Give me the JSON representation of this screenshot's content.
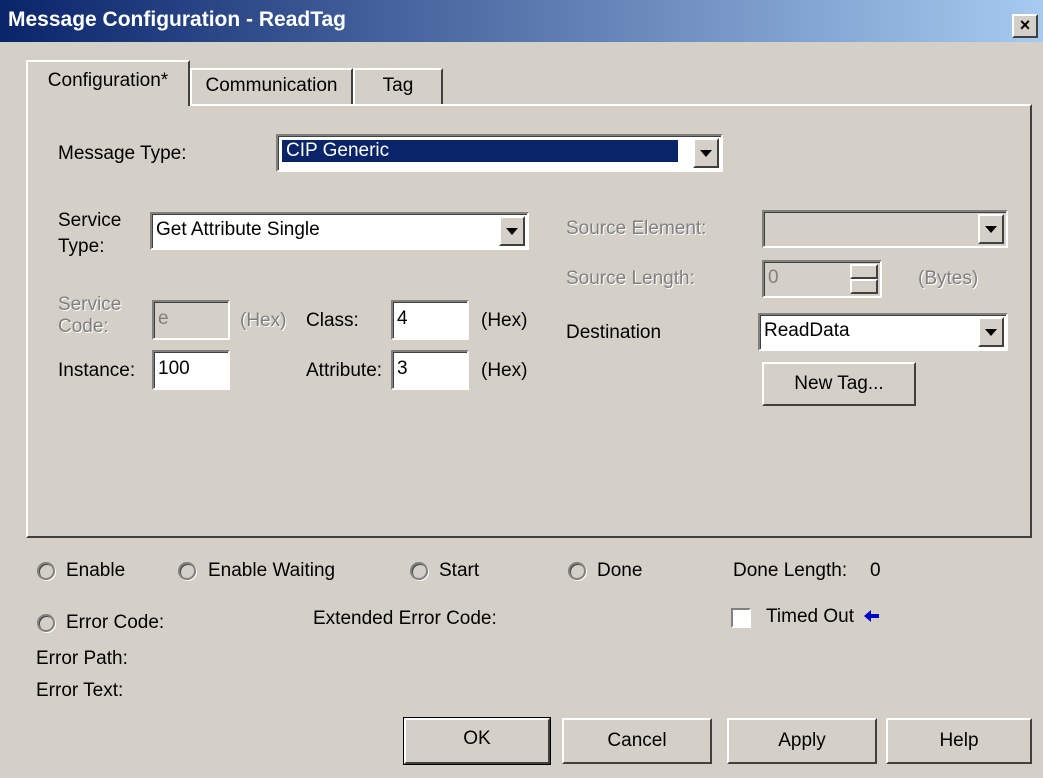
{
  "window": {
    "title": "Message Configuration - ReadTag",
    "close_glyph": "×"
  },
  "tabs": [
    {
      "label": "Configuration*",
      "active": true
    },
    {
      "label": "Communication",
      "active": false
    },
    {
      "label": "Tag",
      "active": false
    }
  ],
  "config": {
    "message_type_label": "Message Type:",
    "message_type_value": "CIP Generic",
    "service_type_label_1": "Service",
    "service_type_label_2": "Type:",
    "service_type_value": "Get Attribute Single",
    "service_code_label_1": "Service",
    "service_code_label_2": "Code:",
    "service_code_value": "e",
    "hex_label": "(Hex)",
    "class_label": "Class:",
    "class_value": "4",
    "instance_label": "Instance:",
    "instance_value": "100",
    "attribute_label": "Attribute:",
    "attribute_value": "3",
    "source_element_label": "Source Element:",
    "source_element_value": "",
    "source_length_label": "Source Length:",
    "source_length_value": "0",
    "bytes_label": "(Bytes)",
    "destination_label": "Destination",
    "destination_value": "ReadData",
    "new_tag_button": "New Tag..."
  },
  "status": {
    "enable": "Enable",
    "enable_waiting": "Enable Waiting",
    "start": "Start",
    "done": "Done",
    "done_length_label": "Done Length:",
    "done_length_value": "0",
    "error_code": "Error Code:",
    "extended_error_code": "Extended Error Code:",
    "timed_out": "Timed Out",
    "error_path": "Error Path:",
    "error_text": "Error Text:"
  },
  "buttons": {
    "ok": "OK",
    "cancel": "Cancel",
    "apply": "Apply",
    "help": "Help"
  },
  "colors": {
    "title_start": "#0a246a",
    "title_end": "#a6caf0",
    "face": "#d4d0c8",
    "selection": "#0a246a",
    "arrow": "#0000cc"
  }
}
